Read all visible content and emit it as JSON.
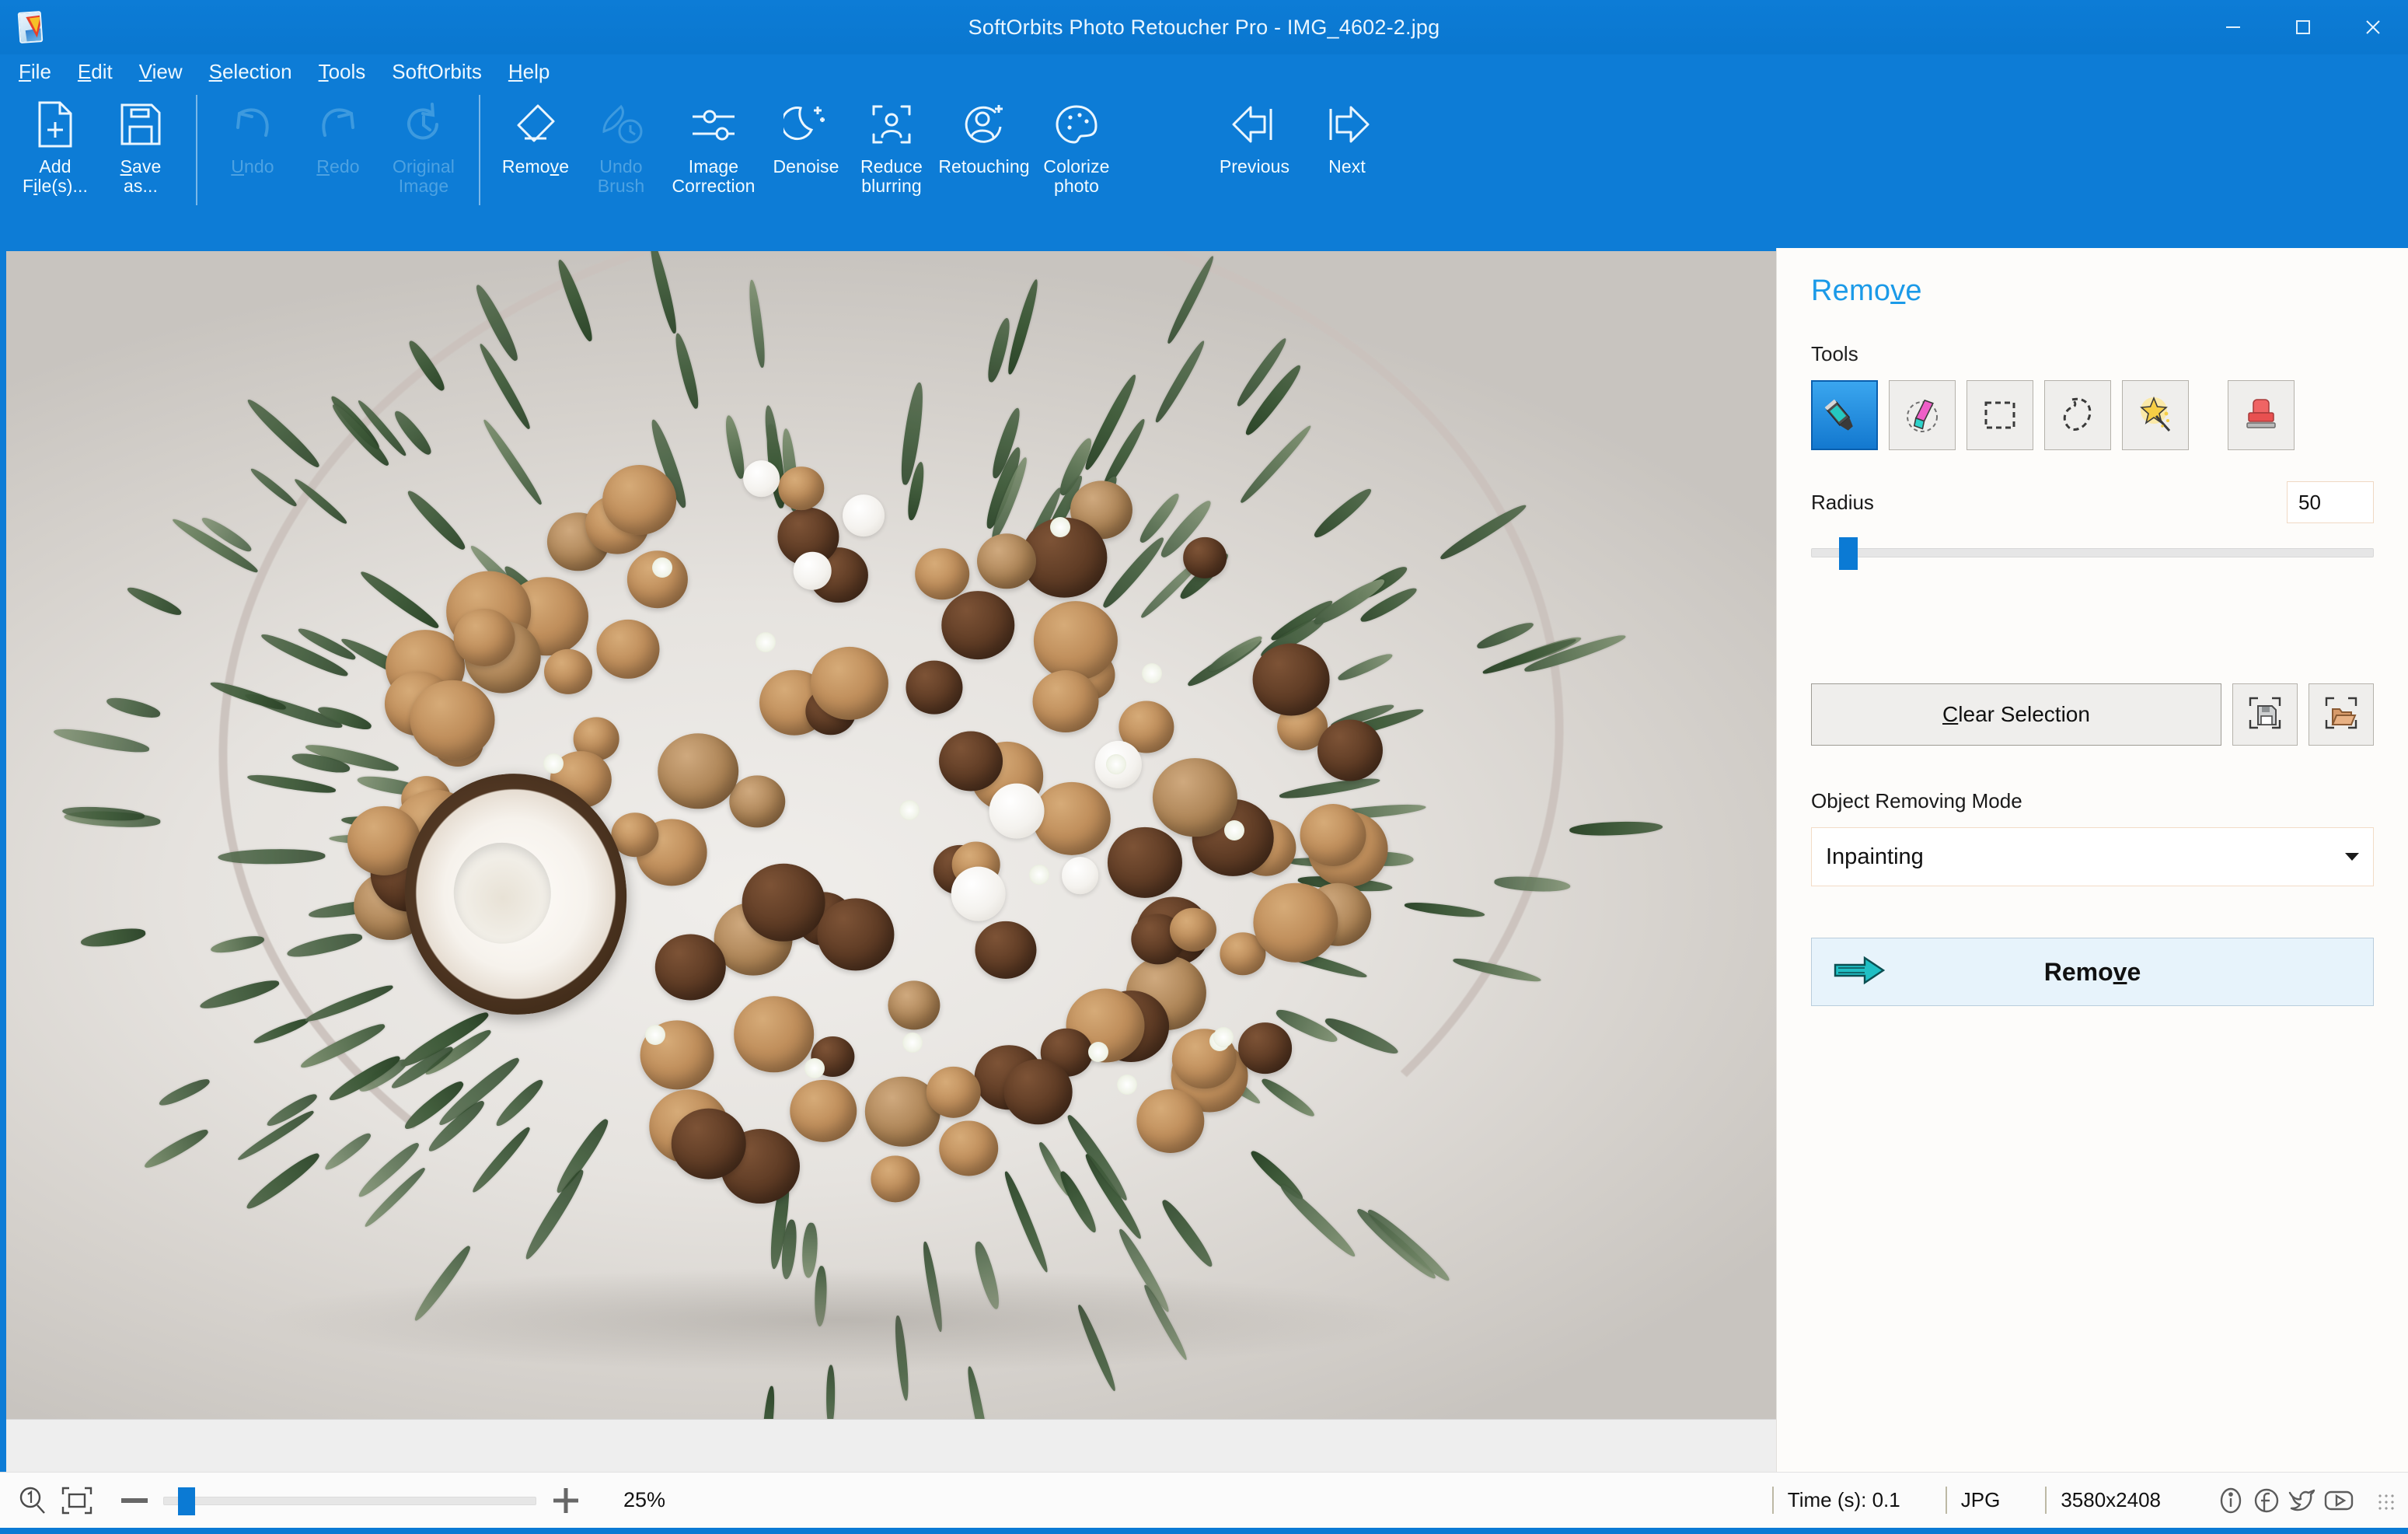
{
  "window": {
    "title": "SoftOrbits Photo Retoucher Pro - IMG_4602-2.jpg",
    "minimize_label": "Minimize",
    "maximize_label": "Maximize",
    "close_label": "Close",
    "accent_color": "#0d7cd6",
    "logo_icon": "app-logo-icon"
  },
  "menubar": {
    "items": [
      {
        "label": "File",
        "accel": "F"
      },
      {
        "label": "Edit",
        "accel": "E"
      },
      {
        "label": "View",
        "accel": "V"
      },
      {
        "label": "Selection",
        "accel": "S"
      },
      {
        "label": "Tools",
        "accel": "T"
      },
      {
        "label": "SoftOrbits",
        "accel": ""
      },
      {
        "label": "Help",
        "accel": "H"
      }
    ]
  },
  "ribbon": {
    "groups": [
      {
        "buttons": [
          {
            "label_line1": "Add",
            "label_line2": "File(s)...",
            "icon": "add-file-icon",
            "disabled": false
          },
          {
            "label_line1": "Save",
            "label_line2": "as...",
            "icon": "save-as-icon",
            "disabled": false
          }
        ]
      },
      {
        "buttons": [
          {
            "label_line1": "Undo",
            "label_line2": "",
            "icon": "undo-arrow-icon",
            "disabled": true
          },
          {
            "label_line1": "Redo",
            "label_line2": "",
            "icon": "redo-arrow-icon",
            "disabled": true
          },
          {
            "label_line1": "Original",
            "label_line2": "Image",
            "icon": "history-clock-icon",
            "disabled": true
          }
        ]
      },
      {
        "buttons": [
          {
            "label_line1": "Remove",
            "label_line2": "",
            "icon": "eraser-icon",
            "disabled": false
          },
          {
            "label_line1": "Undo",
            "label_line2": "Brush",
            "icon": "undo-brush-icon",
            "disabled": true
          },
          {
            "label_line1": "Image",
            "label_line2": "Correction",
            "icon": "sliders-icon",
            "disabled": false
          },
          {
            "label_line1": "Denoise",
            "label_line2": "",
            "icon": "moon-stars-icon",
            "disabled": false
          },
          {
            "label_line1": "Reduce",
            "label_line2": "blurring",
            "icon": "focus-person-icon",
            "disabled": false
          },
          {
            "label_line1": "Retouching",
            "label_line2": "",
            "icon": "person-sparkle-icon",
            "disabled": false
          },
          {
            "label_line1": "Colorize",
            "label_line2": "photo",
            "icon": "palette-icon",
            "disabled": false
          }
        ]
      },
      {
        "buttons": [
          {
            "label_line1": "Previous",
            "label_line2": "",
            "icon": "arrow-left-icon",
            "disabled": false
          },
          {
            "label_line1": "Next",
            "label_line2": "",
            "icon": "arrow-right-icon",
            "disabled": false
          }
        ]
      }
    ]
  },
  "panel": {
    "title": "Remove",
    "title_accel": "v",
    "tools_label": "Tools",
    "tools": [
      {
        "name": "brush-tool",
        "icon": "marker-pen-icon",
        "selected": true
      },
      {
        "name": "eraser-tool",
        "icon": "eraser-color-icon",
        "selected": false
      },
      {
        "name": "rectangle-select-tool",
        "icon": "rectangle-select-icon",
        "selected": false
      },
      {
        "name": "lasso-select-tool",
        "icon": "lasso-icon",
        "selected": false
      },
      {
        "name": "magic-wand-tool",
        "icon": "magic-wand-icon",
        "selected": false
      },
      {
        "name": "clone-stamp-tool",
        "icon": "stamp-icon",
        "selected": false
      }
    ],
    "radius_label": "Radius",
    "radius_value": "50",
    "radius_slider_percent": 5,
    "clear_selection_label": "Clear Selection",
    "clear_selection_accel": "C",
    "save_selection_icon": "save-selection-icon",
    "load_selection_icon": "load-selection-icon",
    "mode_label": "Object Removing Mode",
    "mode_value": "Inpainting",
    "mode_options": [
      "Inpainting"
    ],
    "remove_button_label": "Remove",
    "remove_button_accel": "v",
    "remove_button_icon": "arrow-right-teal-icon"
  },
  "statusbar": {
    "zoom_icon": "zoom-1to1-icon",
    "fit_icon": "fit-to-screen-icon",
    "minus_label": "Zoom out",
    "plus_label": "Zoom in",
    "zoom_percent": "25%",
    "zoom_slider_percent": 4,
    "time_label": "Time (s): 0.1",
    "format_label": "JPG",
    "dimensions_label": "3580x2408",
    "social": [
      {
        "name": "info-icon"
      },
      {
        "name": "facebook-icon"
      },
      {
        "name": "twitter-icon"
      },
      {
        "name": "youtube-icon"
      }
    ]
  },
  "canvas": {
    "image_name": "IMG_4602-2.jpg",
    "description": "photo-of-nut-bouquet"
  }
}
